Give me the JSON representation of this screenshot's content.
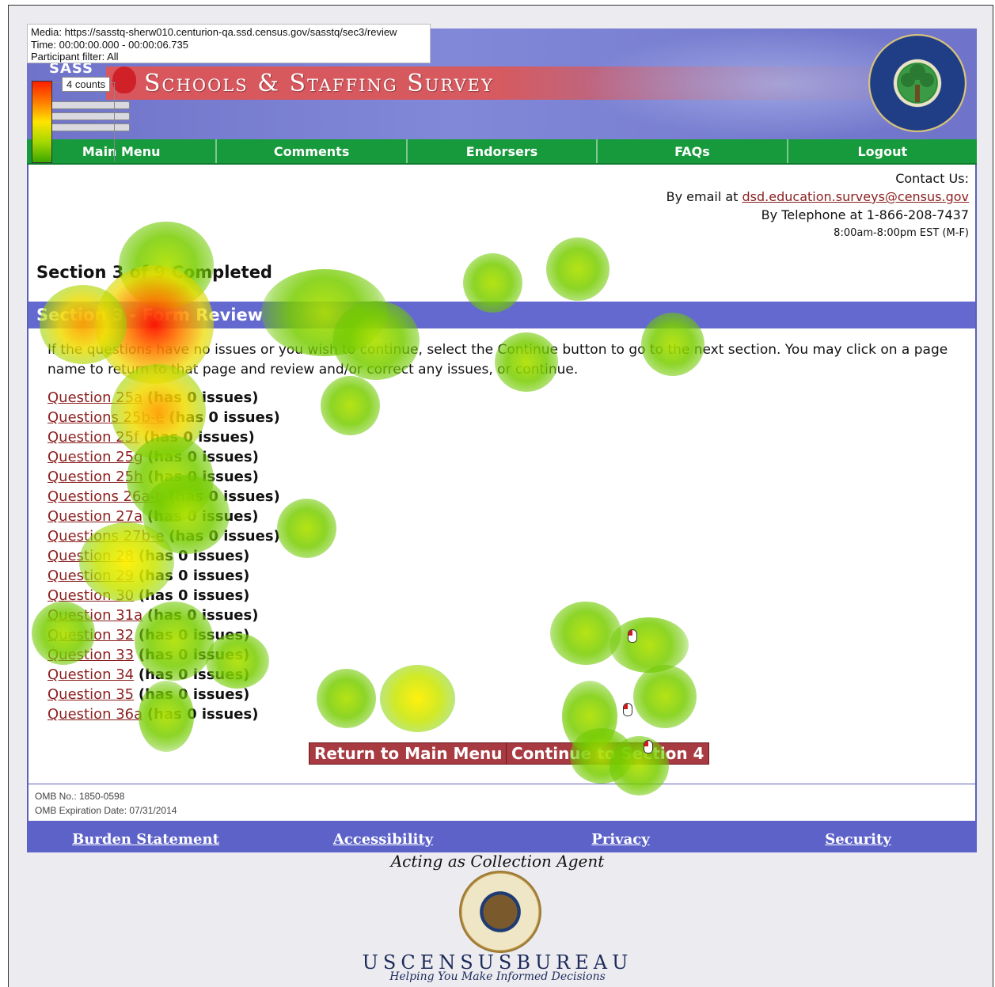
{
  "overlay": {
    "media": "Media: https://sasstq-sherw010.centurion-qa.ssd.census.gov/sasstq/sec3/review",
    "time": "Time: 00:00:00.000 - 00:00:06.735",
    "filter": "Participant filter: All",
    "legend_count": "4 counts",
    "heatmap_colors": [
      "#ff1f00",
      "#ff7a00",
      "#ffe400",
      "#a5d800",
      "#3ca800"
    ]
  },
  "header": {
    "logo_text": "SASS",
    "title": "Schools & Staffing Survey"
  },
  "nav": {
    "items": [
      "Main Menu",
      "Comments",
      "Endorsers",
      "FAQs",
      "Logout"
    ]
  },
  "contact": {
    "heading": "Contact Us:",
    "email_prefix": "By email at ",
    "email": "dsd.education.surveys@census.gov",
    "phone": "By Telephone at 1-866-208-7437",
    "hours": "8:00am-8:00pm EST (M-F)"
  },
  "progress": "Section 3 of 9 Completed",
  "section_title": "Section 3 - Form Review",
  "intro": "If the questions have no issues or you wish to continue, select the Continue button to go to the next section. You may click on a page name to return to that page and review and/or correct any issues, or continue.",
  "questions": [
    {
      "label": "Question 25a",
      "issues": "(has 0 issues)"
    },
    {
      "label": "Questions 25b-e",
      "issues": "(has 0 issues)"
    },
    {
      "label": "Question 25f",
      "issues": "(has 0 issues)"
    },
    {
      "label": "Question 25g",
      "issues": "(has 0 issues)"
    },
    {
      "label": "Question 25h",
      "issues": "(has 0 issues)"
    },
    {
      "label": "Questions 26a-b",
      "issues": "(has 0 issues)"
    },
    {
      "label": "Question 27a",
      "issues": "(has 0 issues)"
    },
    {
      "label": "Questions 27b-e",
      "issues": "(has 0 issues)"
    },
    {
      "label": "Question 28",
      "issues": "(has 0 issues)"
    },
    {
      "label": "Question 29",
      "issues": "(has 0 issues)"
    },
    {
      "label": "Question 30",
      "issues": "(has 0 issues)"
    },
    {
      "label": "Question 31a",
      "issues": "(has 0 issues)"
    },
    {
      "label": "Question 32",
      "issues": "(has 0 issues)"
    },
    {
      "label": "Question 33",
      "issues": "(has 0 issues)"
    },
    {
      "label": "Question 34",
      "issues": "(has 0 issues)"
    },
    {
      "label": "Question 35",
      "issues": "(has 0 issues)"
    },
    {
      "label": "Question 36a",
      "issues": "(has 0 issues)"
    }
  ],
  "buttons": {
    "return": "Return to Main Menu",
    "continue": "Continue to Section 4"
  },
  "omb": {
    "number": "OMB No.: 1850-0598",
    "expiration": "OMB Expiration Date: 07/31/2014"
  },
  "footer": {
    "links": [
      "Burden Statement",
      "Accessibility",
      "Privacy",
      "Security"
    ],
    "agent": "Acting as Collection Agent",
    "census_name": "USCENSUSBUREAU",
    "census_tagline": "Helping You Make Informed Decisions"
  }
}
